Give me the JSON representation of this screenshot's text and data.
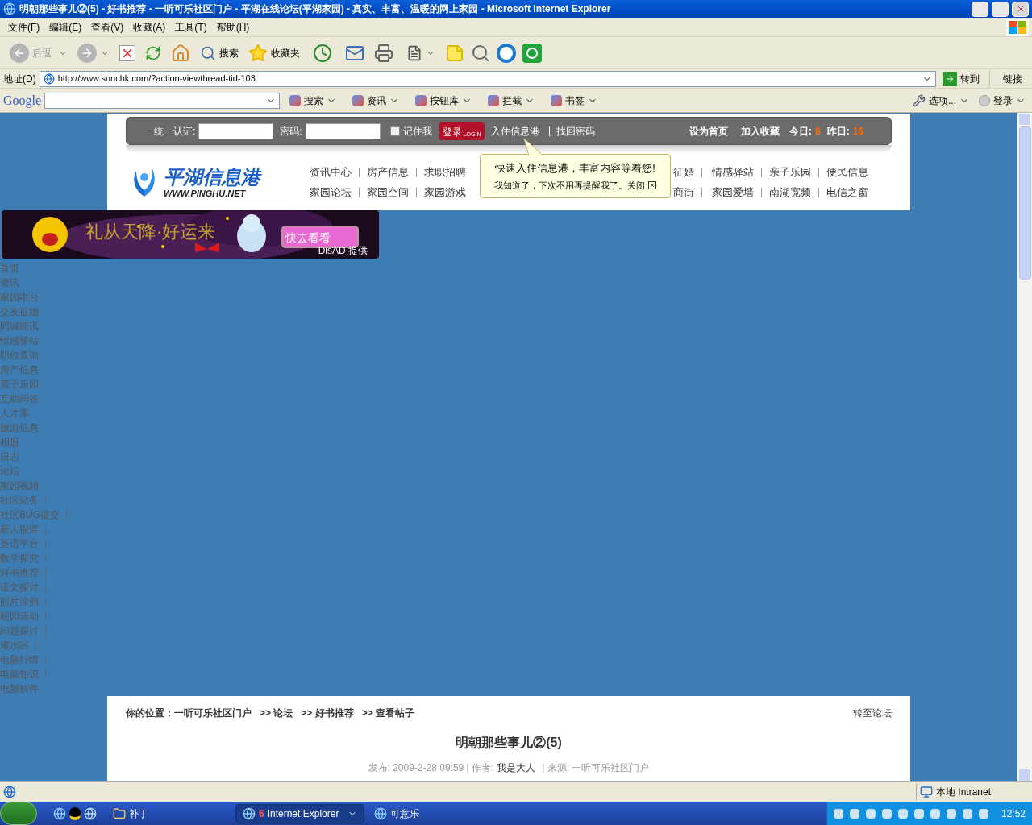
{
  "window": {
    "title": "明朝那些事儿②(5) - 好书推荐 - 一听可乐社区门户 - 平湖在线论坛(平湖家园) - 真实、丰富、温暖的网上家园 - Microsoft Internet Explorer"
  },
  "menu": [
    "文件(F)",
    "编辑(E)",
    "查看(V)",
    "收藏(A)",
    "工具(T)",
    "帮助(H)"
  ],
  "toolbar": {
    "back": {
      "label": "后退",
      "disabled": true
    },
    "search": "搜索",
    "favorites": "收藏夹"
  },
  "address": {
    "label": "地址(D)",
    "url": "http://www.sunchk.com/?action-viewthread-tid-103",
    "go": "转到",
    "links": "链接"
  },
  "google_bar": {
    "logo": "Google",
    "items": [
      "搜索",
      "资讯",
      "按钮库",
      "拦截",
      "书签"
    ],
    "options": "选项...",
    "login": "登录"
  },
  "login_bar": {
    "user_label": "统一认证:",
    "password_label": "密码:",
    "remember": {
      "label": "记住我",
      "checked": false
    },
    "login_button": "登录",
    "login_button_sub": "LOGIN",
    "register": "入住信息港",
    "find_password": "找回密码",
    "set_home": "设为首页",
    "add_favorite": "加入收藏",
    "today_label": "今日:",
    "today": "8",
    "yesterday_label": "昨日:",
    "yesterday": "16"
  },
  "logo": {
    "name": "平湖信息港",
    "url": "WWW.PINGHU.NET"
  },
  "nav_rows": [
    {
      "left": [
        "资讯中心",
        "房产信息",
        "求职招聘"
      ],
      "right": [
        "征婚",
        "情感驿站",
        "亲子乐园",
        "便民信息"
      ]
    },
    {
      "left": [
        "家园论坛",
        "家园空间",
        "家园游戏"
      ],
      "right": [
        "商街",
        "家园爱墙",
        "南湖宽频",
        "电信之窗"
      ]
    }
  ],
  "tooltip": {
    "message": "快速入住信息港，丰富内容等着您!",
    "dismiss": "我知道了，下次不用再提醒我了。关闭"
  },
  "banner": {
    "headline": "礼从天降·好运来",
    "button": "快去看看",
    "credit": "DisAD 提供"
  },
  "side_links": [
    {
      "label": "首页",
      "sep": false
    },
    {
      "label": "资讯",
      "sep": false
    },
    {
      "label": "家园电台",
      "sep": false
    },
    {
      "label": "交友征婚",
      "sep": false
    },
    {
      "label": "同城商讯",
      "sep": false
    },
    {
      "label": "情感驿站",
      "sep": false
    },
    {
      "label": "职位查询",
      "sep": false
    },
    {
      "label": "房产信息",
      "sep": false
    },
    {
      "label": "亲子乐园",
      "sep": false
    },
    {
      "label": "互助问答",
      "sep": false
    },
    {
      "label": "人才库",
      "sep": false
    },
    {
      "label": "旅游信息",
      "sep": false
    },
    {
      "label": "相册",
      "sep": false
    },
    {
      "label": "日志",
      "sep": false
    },
    {
      "label": "论坛",
      "sep": false
    },
    {
      "label": "家园视频",
      "sep": false
    },
    {
      "label": "社区站务",
      "sep": true
    },
    {
      "label": "社区BUG提交",
      "sep": true
    },
    {
      "label": "新人报道",
      "sep": true
    },
    {
      "label": "英语平台",
      "sep": true
    },
    {
      "label": "数学探究",
      "sep": true
    },
    {
      "label": "好书推荐",
      "sep": true
    },
    {
      "label": "语文探讨",
      "sep": true
    },
    {
      "label": "照片涂鸦",
      "sep": true
    },
    {
      "label": "校园活动",
      "sep": true
    },
    {
      "label": "问题探讨",
      "sep": true
    },
    {
      "label": "灌水区",
      "sep": true
    },
    {
      "label": "电脑行情",
      "sep": true
    },
    {
      "label": "电脑知识",
      "sep": true
    },
    {
      "label": "电脑软件",
      "sep": false
    }
  ],
  "article": {
    "breadcrumb_label": "你的位置：",
    "breadcrumb": [
      "一听可乐社区门户",
      ">> 论坛",
      ">> 好书推荐",
      ">> 查看帖子"
    ],
    "forum_link": "转至论坛",
    "title": "明朝那些事儿②(5)",
    "meta_date": "发布: 2009-2-28 09:59 | 作者:",
    "author": "我是大人",
    "meta_source": "| 来源: 一听可乐社区门户"
  },
  "status_bar": {
    "zone": "本地 Intranet"
  },
  "taskbar": {
    "tasks": [
      {
        "label": "补丁",
        "selected": false
      },
      {
        "label": "Internet Explorer",
        "count": "6",
        "selected": true
      },
      {
        "label": "可意乐",
        "selected": false
      }
    ],
    "clock": "12:52"
  }
}
